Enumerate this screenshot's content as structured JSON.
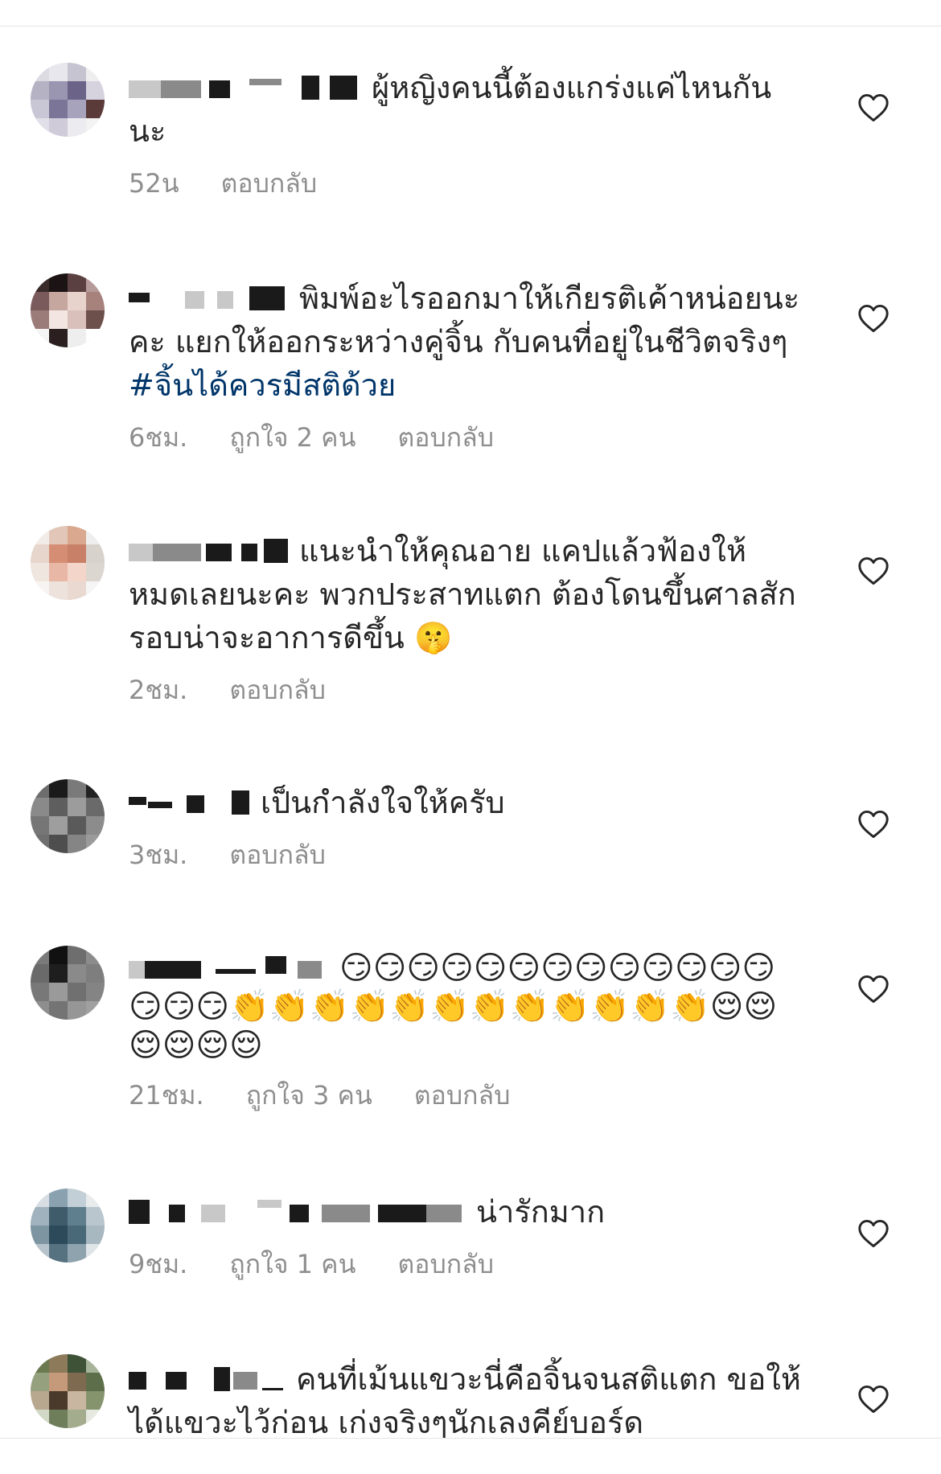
{
  "comments": [
    {
      "text": "ผู้หญิงคนนี้ต้องแกร่งแค่ไหนกันนะ",
      "time": "52น",
      "likes": "",
      "reply": "ตอบกลับ"
    },
    {
      "text": "พิมพ์อะไรออกมาให้เกียรติเค้าหน่อยนะคะ แยกให้ออกระหว่างคู่จิ้น กับคนที่อยู่ในชีวิตจริงๆ ",
      "hashtag": "#จิ้นได้ควรมีสติด้วย",
      "time": "6ชม.",
      "likes": "ถูกใจ 2 คน",
      "reply": "ตอบกลับ"
    },
    {
      "text": "แนะนำให้คุณอาย แคปแล้วฟ้องให้หมดเลยนะคะ พวกประสาทแตก ต้องโดนขึ้นศาลสักรอบน่าจะอาการดีขึ้น 🤫",
      "time": "2ชม.",
      "likes": "",
      "reply": "ตอบกลับ"
    },
    {
      "text": "เป็นกำลังใจให้ครับ",
      "time": "3ชม.",
      "likes": "",
      "reply": "ตอบกลับ"
    },
    {
      "text": "😏😏😏😏😏😏😏😏😏😏😏😏😏😏😏😏👏👏👏👏👏👏👏👏👏👏👏👏😌😌😌😌😌😌",
      "time": "21ชม.",
      "likes": "ถูกใจ 3 คน",
      "reply": "ตอบกลับ"
    },
    {
      "text": "น่ารักมาก",
      "time": "9ชม.",
      "likes": "ถูกใจ 1 คน",
      "reply": "ตอบกลับ"
    },
    {
      "text": "คนที่เม้นแขวะนี่คือจิ้นจนสติแตก ขอให้ได้แขวะไว้ก่อน เก่งจริงๆนักเลงคีย์บอร์ด",
      "time": "",
      "likes": "",
      "reply": ""
    }
  ],
  "icons": {
    "like": "heart-outline-icon"
  },
  "colors": {
    "text": "#262626",
    "meta": "#8e8e8e",
    "hashtag": "#003569",
    "divider": "#e4e4e4"
  }
}
